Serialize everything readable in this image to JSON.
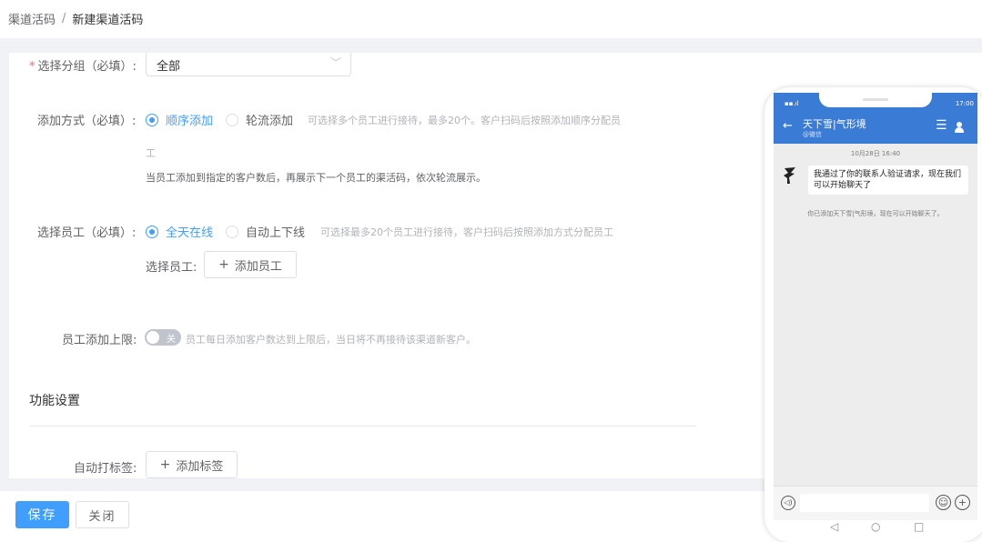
{
  "breadcrumb": {
    "parent": "渠道活码",
    "separator": "/",
    "current": "新建渠道活码"
  },
  "form": {
    "group": {
      "required_mark": "*",
      "label": "选择分组（必填）:",
      "value": "全部"
    },
    "add_method": {
      "label": "添加方式（必填）:",
      "options": [
        "顺序添加",
        "轮流添加"
      ],
      "selected": "顺序添加",
      "hint_line1": "可选择多个员工进行接待，最多20个。客户扫码后按照添加顺序分配员",
      "hint_line2": "工",
      "note": "当员工添加到指定的客户数后，再展示下一个员工的渠活码，依次轮流展示。"
    },
    "staff": {
      "label": "选择员工（必填）:",
      "options": [
        "全天在线",
        "自动上下线"
      ],
      "selected": "全天在线",
      "hint": "可选择最多20个员工进行接待，客户扫码后按照添加方式分配员工",
      "select_label": "选择员工:",
      "add_button": "添加员工"
    },
    "limit": {
      "label": "员工添加上限:",
      "switch_text": "关",
      "switch_on": false,
      "hint": "员工每日添加客户数达到上限后，当日将不再接待该渠道新客户。"
    },
    "feature_section_title": "功能设置",
    "auto_tag": {
      "label": "自动打标签:",
      "add_button": "添加标签"
    }
  },
  "footer": {
    "save": "保存",
    "close": "关闭"
  },
  "colors": {
    "primary": "#409eff",
    "wechat_header": "#3a7bd5",
    "page_bg": "#f0f2f5"
  },
  "phone": {
    "status_time": "17:00",
    "chat_title": "天下雪|气形境",
    "chat_sub": "@微信",
    "timestamp": "10月28日 16:40",
    "message": "我通过了你的联系人验证请求，现在我们可以开始聊天了",
    "system_message": "你已添加天下雪|气形境，现在可以开始聊天了。",
    "icons": [
      "back-arrow-icon",
      "menu-icon",
      "person-icon",
      "voice-icon",
      "emoji-icon",
      "plus-icon"
    ]
  }
}
